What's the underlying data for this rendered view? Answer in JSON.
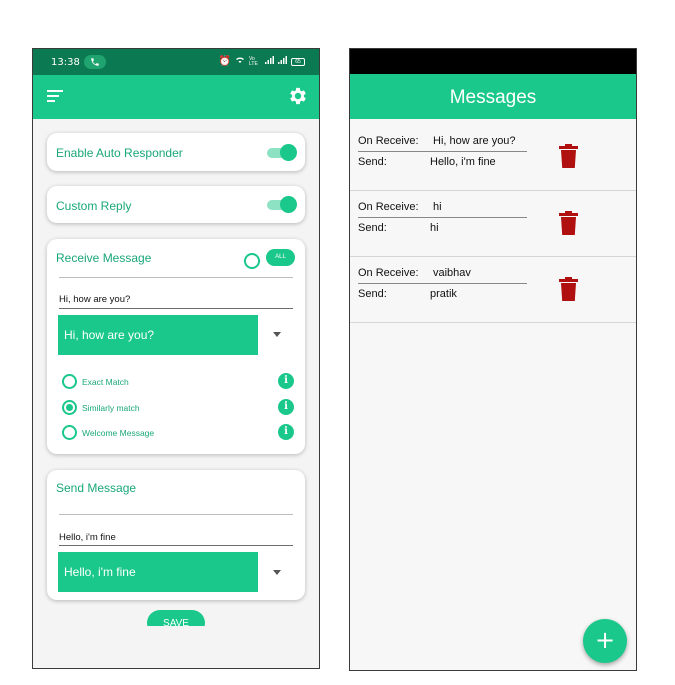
{
  "left_screen": {
    "status": {
      "time": "13:38",
      "network_label": "Vo LTE",
      "battery": "65"
    },
    "settings": {
      "auto_responder_label": "Enable Auto Responder",
      "auto_responder_on": true,
      "custom_reply_label": "Custom Reply",
      "custom_reply_on": true
    },
    "receive": {
      "title": "Receive Message",
      "all_button": "ALL",
      "input_value": "Hi, how are you?",
      "selected_option": "Hi, how are you?",
      "options": [
        {
          "label": "Exact Match",
          "selected": false
        },
        {
          "label": "Similarly match",
          "selected": true
        },
        {
          "label": "Welcome Message",
          "selected": false
        }
      ],
      "info_glyph": "i"
    },
    "send": {
      "title": "Send Message",
      "input_value": "Hello, i'm fine",
      "selected_option": "Hello, i'm fine"
    },
    "save_label": "SAVE"
  },
  "right_screen": {
    "title": "Messages",
    "receive_key": "On Receive:",
    "send_key": "Send:",
    "messages": [
      {
        "receive": "Hi, how are you?",
        "send": "Hello, i'm fine"
      },
      {
        "receive": "hi",
        "send": "hi"
      },
      {
        "receive": "vaibhav",
        "send": "pratik"
      }
    ],
    "fab_label": "+"
  },
  "colors": {
    "accent": "#19c88a",
    "status_bar": "#0b7a52",
    "delete": "#b01010"
  },
  "icons": [
    "menu-icon",
    "gear-icon",
    "info-icon",
    "trash-icon",
    "add-icon",
    "phone-icon"
  ]
}
